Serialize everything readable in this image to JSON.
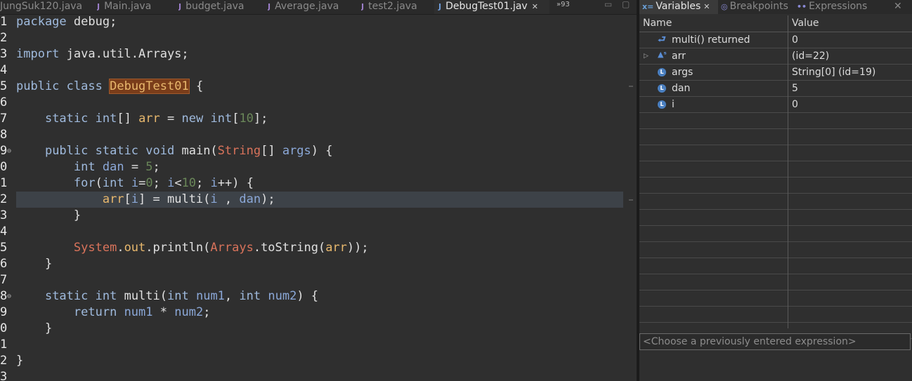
{
  "editor": {
    "tabs": [
      {
        "label": "JungSuk120.java",
        "icon": "java-file-icon",
        "active": false
      },
      {
        "label": "Main.java",
        "icon": "java-file-icon",
        "active": false
      },
      {
        "label": "budget.java",
        "icon": "java-file-icon",
        "active": false
      },
      {
        "label": "Average.java",
        "icon": "java-file-icon",
        "active": false
      },
      {
        "label": "test2.java",
        "icon": "java-file-icon",
        "active": false
      },
      {
        "label": "DebugTest01.jav",
        "icon": "java-file-icon",
        "active": true
      }
    ],
    "overflow_label": "93",
    "current_line": 12,
    "lines": [
      {
        "n": "1",
        "code": "package debug;"
      },
      {
        "n": "2",
        "code": ""
      },
      {
        "n": "3",
        "code": "import java.util.Arrays;"
      },
      {
        "n": "4",
        "code": ""
      },
      {
        "n": "5",
        "code": "public class DebugTest01 {"
      },
      {
        "n": "6",
        "code": ""
      },
      {
        "n": "7",
        "code": "    static int[] arr = new int[10];"
      },
      {
        "n": "8",
        "code": ""
      },
      {
        "n": "9",
        "code": "    public static void main(String[] args) {"
      },
      {
        "n": "0",
        "code": "        int dan = 5;"
      },
      {
        "n": "1",
        "code": "        for(int i=0; i<10; i++) {"
      },
      {
        "n": "2",
        "code": "            arr[i] = multi(i , dan);"
      },
      {
        "n": "3",
        "code": "        }"
      },
      {
        "n": "4",
        "code": ""
      },
      {
        "n": "5",
        "code": "        System.out.println(Arrays.toString(arr));"
      },
      {
        "n": "6",
        "code": "    }"
      },
      {
        "n": "7",
        "code": ""
      },
      {
        "n": "8",
        "code": "    static int multi(int num1, int num2) {"
      },
      {
        "n": "9",
        "code": "        return num1 * num2;"
      },
      {
        "n": "0",
        "code": "    }"
      },
      {
        "n": "1",
        "code": ""
      },
      {
        "n": "2",
        "code": "}"
      },
      {
        "n": "3",
        "code": ""
      }
    ]
  },
  "debug_panel": {
    "tabs": [
      {
        "label": "Variables",
        "icon": "variables-icon",
        "active": true
      },
      {
        "label": "Breakpoints",
        "icon": "breakpoints-icon",
        "active": false
      },
      {
        "label": "Expressions",
        "icon": "expressions-icon",
        "active": false
      }
    ],
    "columns": [
      "Name",
      "Value"
    ],
    "variables": [
      {
        "name": "multi() returned",
        "value": "0",
        "icon": "return-value-icon",
        "expandable": false
      },
      {
        "name": "arr",
        "value": "(id=22)",
        "icon": "static-field-icon",
        "expandable": true
      },
      {
        "name": "args",
        "value": "String[0]  (id=19)",
        "icon": "local-variable-icon",
        "expandable": false
      },
      {
        "name": "dan",
        "value": "5",
        "icon": "local-variable-icon",
        "expandable": false
      },
      {
        "name": "i",
        "value": "0",
        "icon": "local-variable-icon",
        "expandable": false
      }
    ],
    "expression_placeholder": "<Choose a previously entered expression>"
  }
}
